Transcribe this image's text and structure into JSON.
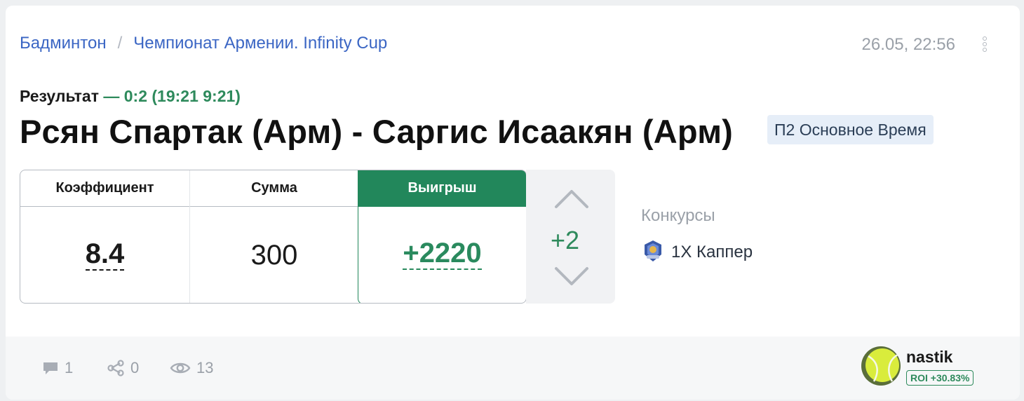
{
  "breadcrumb": {
    "sport": "Бадминтон",
    "separator": "/",
    "tournament": "Чемпионат Армении. Infinity Cup"
  },
  "date": "26.05, 22:56",
  "result": {
    "label": "Результат",
    "value": "— 0:2 (19:21 9:21)"
  },
  "match_title": "Рсян Спартак (Арм) - Саргис Исаакян (Арм)",
  "bet_type": "П2 Основное Время",
  "stats": {
    "odds_label": "Коэффициент",
    "odds_value": "8.4",
    "stake_label": "Сумма",
    "stake_value": "300",
    "win_label": "Выигрыш",
    "win_value": "+2220"
  },
  "rating": {
    "value": "+2"
  },
  "contests": {
    "title": "Конкурсы",
    "items": [
      {
        "label": "1X Каппер",
        "icon": "trophy-badge-icon"
      }
    ]
  },
  "footer": {
    "comments": "1",
    "shares": "0",
    "views": "13"
  },
  "author": {
    "name": "nastik",
    "roi": "ROI +30.83%"
  },
  "colors": {
    "accent_green": "#22875b",
    "link_blue": "#3b66c4",
    "muted_gray": "#9aa0a8"
  }
}
